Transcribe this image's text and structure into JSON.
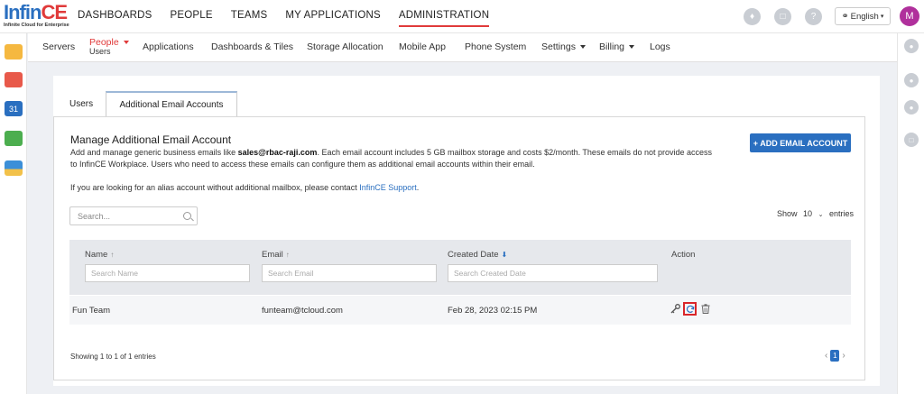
{
  "brand": {
    "logo_main": "Infin",
    "logo_ce": "CE",
    "tagline": "Infinite Cloud for Enterprise"
  },
  "topnav": [
    {
      "label": "DASHBOARDS",
      "active": false
    },
    {
      "label": "PEOPLE",
      "active": false
    },
    {
      "label": "TEAMS",
      "active": false
    },
    {
      "label": "MY APPLICATIONS",
      "active": false
    },
    {
      "label": "ADMINISTRATION",
      "active": true
    }
  ],
  "header": {
    "language": "English",
    "avatar_initial": "M",
    "icons": [
      "bell-icon",
      "clipboard-icon",
      "help-icon"
    ]
  },
  "subnav": {
    "servers": "Servers",
    "people": "People",
    "people_sub": "Users",
    "applications": "Applications",
    "dashboards_tiles": "Dashboards & Tiles",
    "storage": "Storage Allocation",
    "mobile": "Mobile App",
    "phone": "Phone System",
    "settings": "Settings",
    "billing": "Billing",
    "logs": "Logs"
  },
  "tabs": {
    "users": "Users",
    "additional": "Additional Email Accounts"
  },
  "panel": {
    "title": "Manage Additional Email Account",
    "desc_pre": "Add and manage generic business emails like ",
    "desc_email": "sales@rbac-raji.com",
    "desc_post": ". Each email account includes 5 GB mailbox storage and costs $2/month. These emails do not provide access to InfinCE Workplace. Users who need to access these emails can configure them as additional email accounts within their email.",
    "alias_pre": "If you are looking for an alias account without additional mailbox, please contact ",
    "alias_link": "InfinCE  Support",
    "alias_post": ".",
    "add_button": "+ ADD EMAIL ACCOUNT",
    "search_placeholder": "Search...",
    "show_label": "Show",
    "show_value": "10",
    "entries_label": "entries"
  },
  "table": {
    "columns": [
      {
        "label": "Name",
        "arrow": "↑",
        "filter": "Search Name"
      },
      {
        "label": "Email",
        "arrow": "↑",
        "filter": "Search Email"
      },
      {
        "label": "Created Date",
        "arrow": "⬇",
        "filter": "Search Created Date"
      },
      {
        "label": "Action"
      }
    ],
    "rows": [
      {
        "name": "Fun Team",
        "email": "funteam@tcloud.com",
        "created": "Feb 28, 2023 02:15 PM"
      }
    ]
  },
  "footer": {
    "showing": "Showing 1 to 1 of 1 entries",
    "page": "1",
    "prev": "‹",
    "next": "›"
  },
  "colors": {
    "accent": "#2a6fc0",
    "brand_red": "#e03a3a",
    "avatar": "#b0309c"
  }
}
